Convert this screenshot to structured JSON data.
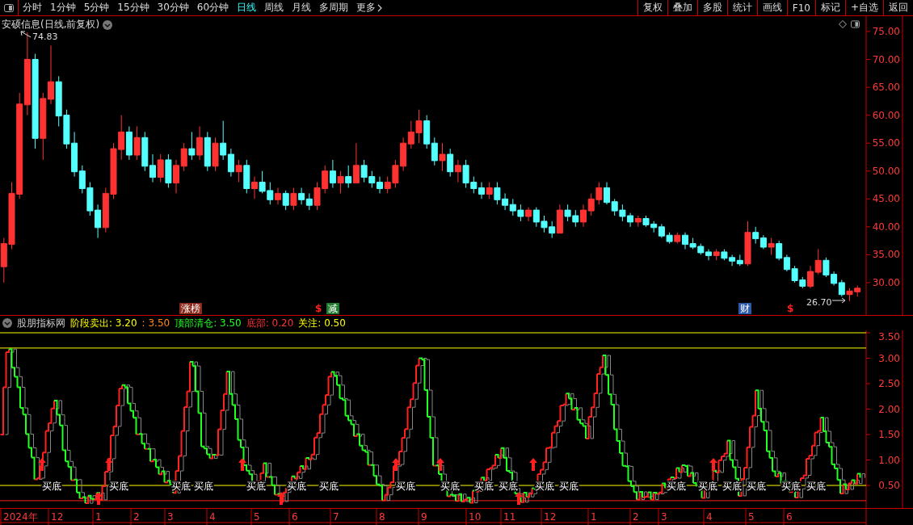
{
  "toolbar": {
    "periods": [
      {
        "label": "分时",
        "selected": false
      },
      {
        "label": "1分钟",
        "selected": false
      },
      {
        "label": "5分钟",
        "selected": false
      },
      {
        "label": "15分钟",
        "selected": false
      },
      {
        "label": "30分钟",
        "selected": false
      },
      {
        "label": "60分钟",
        "selected": false
      },
      {
        "label": "日线",
        "selected": true
      },
      {
        "label": "周线",
        "selected": false
      },
      {
        "label": "月线",
        "selected": false
      },
      {
        "label": "多周期",
        "selected": false
      },
      {
        "label": "更多",
        "selected": false
      }
    ],
    "buttons": [
      "复权",
      "叠加",
      "多股",
      "统计",
      "画线",
      "F10",
      "标记",
      "+自选",
      "返回"
    ]
  },
  "price_chart": {
    "title": "安硕信息(日线,前复权)",
    "high_label": "74.83",
    "low_label": "26.70",
    "chart_data": {
      "type": "candlestick",
      "ylim": [
        24.2,
        77.75
      ],
      "yticks": [
        {
          "value": 75,
          "label": "75.00"
        },
        {
          "value": 70,
          "label": "70.00"
        },
        {
          "value": 65,
          "label": "65.00"
        },
        {
          "value": 60,
          "label": "60.00"
        },
        {
          "value": 55,
          "label": "55.00"
        },
        {
          "value": 50,
          "label": "50.00"
        },
        {
          "value": 45,
          "label": "45.00"
        },
        {
          "value": 40,
          "label": "40.00"
        },
        {
          "value": 35,
          "label": "35.00"
        },
        {
          "value": 30,
          "label": "30.00"
        }
      ],
      "ohlc": [
        [
          33,
          38,
          30,
          37
        ],
        [
          37,
          48,
          36,
          46
        ],
        [
          46,
          64,
          45,
          62
        ],
        [
          62,
          74.83,
          60,
          70
        ],
        [
          70,
          71,
          54,
          56
        ],
        [
          56,
          64,
          52,
          63
        ],
        [
          63,
          72.5,
          62,
          66
        ],
        [
          66,
          67,
          58,
          60
        ],
        [
          60,
          61,
          54,
          55
        ],
        [
          55,
          57,
          49,
          50
        ],
        [
          50,
          51,
          46,
          47
        ],
        [
          47,
          48,
          42,
          43
        ],
        [
          43,
          44,
          38,
          40
        ],
        [
          40,
          47,
          39,
          46
        ],
        [
          46,
          55,
          45,
          54
        ],
        [
          54,
          60,
          52,
          57
        ],
        [
          57,
          58,
          52,
          53
        ],
        [
          53,
          58,
          52,
          56
        ],
        [
          56,
          57,
          50,
          51
        ],
        [
          51,
          53,
          48,
          49
        ],
        [
          49,
          53,
          48,
          52
        ],
        [
          52,
          53,
          47,
          48
        ],
        [
          48,
          52,
          46,
          51
        ],
        [
          51,
          55,
          50,
          54
        ],
        [
          54,
          57,
          52,
          53
        ],
        [
          53,
          58,
          52,
          56
        ],
        [
          56,
          57,
          50,
          51
        ],
        [
          51,
          56,
          50,
          55
        ],
        [
          55,
          59,
          52,
          53
        ],
        [
          53,
          54,
          49,
          50
        ],
        [
          50,
          52,
          48,
          51
        ],
        [
          51,
          52,
          46,
          47
        ],
        [
          47,
          49,
          45,
          48
        ],
        [
          48,
          50,
          46,
          46.5
        ],
        [
          46.5,
          48,
          44,
          45
        ],
        [
          45,
          47,
          44,
          46
        ],
        [
          46,
          46.5,
          43,
          44
        ],
        [
          44,
          47,
          43,
          46
        ],
        [
          46,
          47,
          44,
          45
        ],
        [
          45,
          46,
          43,
          44
        ],
        [
          44,
          48,
          43,
          47
        ],
        [
          47,
          51,
          46,
          50
        ],
        [
          50,
          52,
          47,
          48
        ],
        [
          48,
          50,
          46,
          49
        ],
        [
          49,
          51,
          47,
          48
        ],
        [
          48,
          55,
          48,
          51
        ],
        [
          51,
          52,
          48,
          49
        ],
        [
          49,
          50,
          47,
          48
        ],
        [
          48,
          49,
          46,
          47
        ],
        [
          47,
          49,
          46,
          48
        ],
        [
          48,
          52,
          47,
          51
        ],
        [
          51,
          56,
          50,
          55
        ],
        [
          55,
          59,
          54,
          57
        ],
        [
          57,
          61,
          55,
          59
        ],
        [
          59,
          60,
          54,
          55
        ],
        [
          55,
          56,
          51,
          52
        ],
        [
          52,
          55,
          50,
          53
        ],
        [
          53,
          54,
          49,
          50
        ],
        [
          50,
          52,
          48,
          51
        ],
        [
          51,
          52,
          47,
          48
        ],
        [
          48,
          49,
          46,
          47
        ],
        [
          47,
          48,
          45,
          46
        ],
        [
          46,
          48,
          45,
          47
        ],
        [
          47,
          48,
          44,
          45
        ],
        [
          45,
          46,
          43,
          44
        ],
        [
          44,
          45,
          42,
          43
        ],
        [
          43,
          44,
          41,
          42
        ],
        [
          42,
          43.5,
          41,
          43
        ],
        [
          43,
          43.5,
          40,
          41
        ],
        [
          41,
          42,
          39,
          40
        ],
        [
          40,
          41,
          38,
          39
        ],
        [
          39,
          44,
          39,
          43
        ],
        [
          43,
          44,
          41,
          42
        ],
        [
          42,
          43,
          40,
          41
        ],
        [
          41,
          44,
          40,
          43
        ],
        [
          43,
          46,
          42,
          45
        ],
        [
          45,
          48,
          44,
          47
        ],
        [
          47,
          48,
          44,
          44.5
        ],
        [
          44.5,
          45,
          42,
          43
        ],
        [
          43,
          44,
          41,
          42
        ],
        [
          42,
          42.5,
          40,
          41
        ],
        [
          41,
          42,
          40,
          41.5
        ],
        [
          41.5,
          42,
          40,
          40.5
        ],
        [
          40.5,
          41,
          39,
          40
        ],
        [
          40,
          40.5,
          38,
          38.5
        ],
        [
          38.5,
          39,
          37,
          37.5
        ],
        [
          37.5,
          39,
          37,
          38.5
        ],
        [
          38.5,
          39,
          36,
          37
        ],
        [
          37,
          38,
          36,
          36.5
        ],
        [
          36.5,
          37,
          35,
          35.5
        ],
        [
          35.5,
          36,
          34,
          35
        ],
        [
          35,
          36,
          34,
          35.5
        ],
        [
          35.5,
          36,
          34,
          34.5
        ],
        [
          34.5,
          35,
          33,
          34
        ],
        [
          34,
          35,
          33,
          33.5
        ],
        [
          33.5,
          41,
          33,
          39
        ],
        [
          39,
          40,
          37,
          38
        ],
        [
          38,
          38.5,
          36,
          36.5
        ],
        [
          36.5,
          38,
          35,
          37
        ],
        [
          37,
          37.5,
          34,
          34.5
        ],
        [
          34.5,
          35,
          32,
          32.5
        ],
        [
          32.5,
          33,
          30,
          30.5
        ],
        [
          30.5,
          31,
          29,
          29.5
        ],
        [
          29.5,
          33,
          29,
          32
        ],
        [
          32,
          36,
          31.5,
          34
        ],
        [
          34,
          34.5,
          31,
          31.5
        ],
        [
          31.5,
          32,
          29.5,
          30
        ],
        [
          30,
          30.5,
          27.5,
          28
        ],
        [
          28,
          29,
          26.7,
          28.5
        ],
        [
          28.5,
          29.5,
          27.5,
          29
        ]
      ]
    },
    "markers": [
      {
        "text": "涨榜",
        "kind": "tag",
        "color": "#8b2b1c"
      },
      {
        "text": "$",
        "kind": "symbol",
        "color": "#ff2020"
      },
      {
        "text": "减",
        "kind": "tag",
        "color": "#1f7a2e"
      },
      {
        "text": "财",
        "kind": "tag",
        "color": "#2a5aa8"
      },
      {
        "text": "$",
        "kind": "symbol",
        "color": "#ff2020"
      }
    ]
  },
  "indicator": {
    "name": "股朋指标网",
    "legend": [
      {
        "text": "阶段卖出: 3.20",
        "color": "#ffff00"
      },
      {
        "text": ": 3.50",
        "color": "#ff8c1a"
      },
      {
        "text": "顶部清仓: 3.50",
        "color": "#22ff22"
      },
      {
        "text": "底部: 0.20",
        "color": "#ff3030"
      },
      {
        "text": "关注: 0.50",
        "color": "#ffff00"
      }
    ],
    "axis_labels": [
      "3.50",
      "3.00",
      "2.50",
      "2.00",
      "1.50",
      "1.00",
      "0.50"
    ],
    "signals": [
      "买底",
      "买底",
      "买底",
      "买底",
      "买底",
      "买底",
      "买底",
      "买底",
      "买底",
      "买底",
      "买底",
      "买底",
      "买底",
      "买底",
      "买底",
      "买底",
      "买底",
      "买底",
      "买底"
    ]
  },
  "date_axis": {
    "labels": [
      "2024年",
      "12",
      "1",
      "2",
      "3",
      "4",
      "5",
      "6",
      "7",
      "8",
      "9",
      "10",
      "11",
      "12",
      "1",
      "2",
      "3",
      "4",
      "5",
      "6"
    ]
  }
}
